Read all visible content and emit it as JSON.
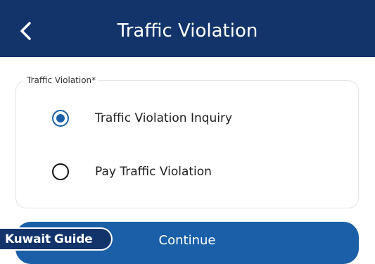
{
  "header": {
    "title": "Traffic Violation",
    "back_icon": "chevron-left-icon"
  },
  "form": {
    "legend": "Traffic Violation*",
    "options": [
      {
        "label": "Traffic Violation Inquiry",
        "selected": true
      },
      {
        "label": "Pay Traffic Violation",
        "selected": false
      }
    ]
  },
  "actions": {
    "continue_label": "Continue"
  },
  "watermark": {
    "word1": "Kuwait",
    "word2": "Guide"
  },
  "colors": {
    "header_bg": "#13346b",
    "accent": "#1a5fa8",
    "border": "#e3e3e3"
  }
}
